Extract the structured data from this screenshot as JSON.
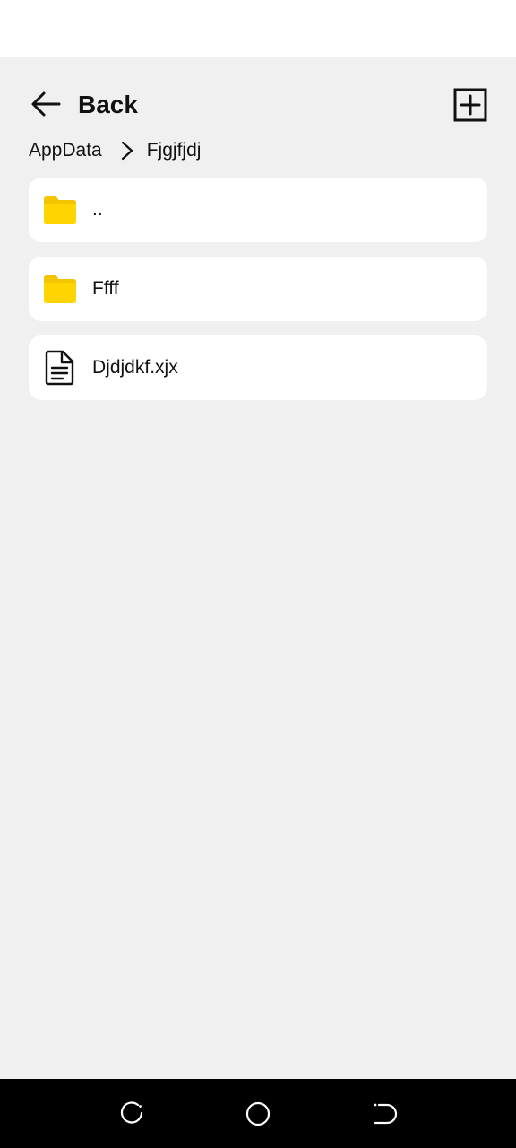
{
  "header": {
    "back_label": "Back",
    "back_icon": "arrow-left-icon",
    "add_icon": "plus-square-icon"
  },
  "breadcrumb": {
    "items": [
      "AppData",
      "Fjgjfjdj"
    ],
    "separator_icon": "chevron-right-icon"
  },
  "files": [
    {
      "name": "..",
      "type": "folder",
      "icon": "folder-icon"
    },
    {
      "name": "Ffff",
      "type": "folder",
      "icon": "folder-icon"
    },
    {
      "name": "Djdjdkf.xjx",
      "type": "file",
      "icon": "document-icon"
    }
  ],
  "colors": {
    "background": "#f0f0f0",
    "card": "#ffffff",
    "folder": "#ffd400",
    "nav_bar": "#000000"
  },
  "nav_bar": {
    "buttons": [
      "recents-icon",
      "home-icon",
      "back-icon"
    ]
  }
}
